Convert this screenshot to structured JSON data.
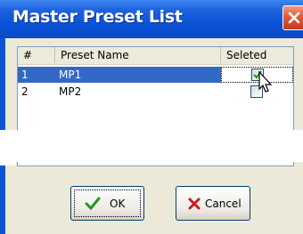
{
  "window": {
    "title": "Master Preset List"
  },
  "list": {
    "columns": [
      "#",
      "Preset Name",
      "Seleted"
    ],
    "rows": [
      {
        "num": "1",
        "name": "MP1",
        "checked": true,
        "selected": true
      },
      {
        "num": "2",
        "name": "MP2",
        "checked": false,
        "selected": false
      }
    ]
  },
  "buttons": {
    "ok": "OK",
    "cancel": "Cancel"
  },
  "colors": {
    "selection": "#316ac5",
    "titlebar": "#0b52d8",
    "dialog": "#ece9d8"
  }
}
